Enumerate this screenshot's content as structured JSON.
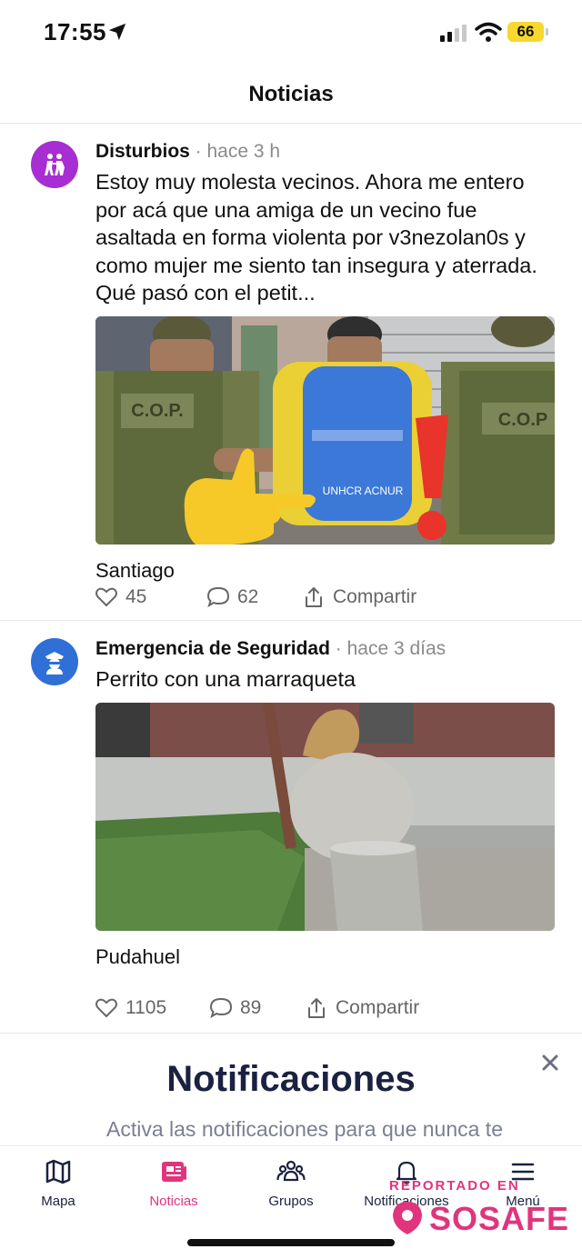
{
  "status_bar": {
    "time": "17:55",
    "battery": "66"
  },
  "header": {
    "title": "Noticias"
  },
  "posts": [
    {
      "category": "Disturbios",
      "time": " · hace 3 h",
      "body": "Estoy muy molesta vecinos. Ahora me entero por acá que una amiga de un vecino fue asaltada en forma violenta por v3nezolan0s y como mujer me siento tan insegura y aterrada. Qué pasó con el petit...",
      "image_text_vest_left": "C.O.P.",
      "image_text_vest_right": "C.O.P",
      "image_text_backpack": "UNHCR ACNUR",
      "location": "Santiago",
      "likes": "45",
      "comments": "62",
      "share_label": "Compartir"
    },
    {
      "category": "Emergencia de Seguridad",
      "time": " · hace 3 días",
      "body": "Perrito con una marraqueta",
      "location": "Pudahuel",
      "likes": "1105",
      "comments": "89",
      "share_label": "Compartir"
    }
  ],
  "promo": {
    "title": "Notificaciones",
    "text": "Activa las notificaciones para que nunca te"
  },
  "tabs": [
    {
      "label": "Mapa",
      "icon": "map-icon"
    },
    {
      "label": "Noticias",
      "icon": "news-icon",
      "active": true
    },
    {
      "label": "Grupos",
      "icon": "groups-icon"
    },
    {
      "label": "Notificaciones",
      "icon": "bell-icon"
    },
    {
      "label": "Menú",
      "icon": "menu-icon"
    }
  ],
  "watermark": {
    "top": "REPORTADO EN",
    "brand": "SOSAFE"
  },
  "colors": {
    "accent": "#e0357d",
    "purple_avatar": "#a72ed2",
    "blue_avatar": "#2f6fd7",
    "battery": "#f7d830",
    "dark_navy": "#1b2140"
  }
}
